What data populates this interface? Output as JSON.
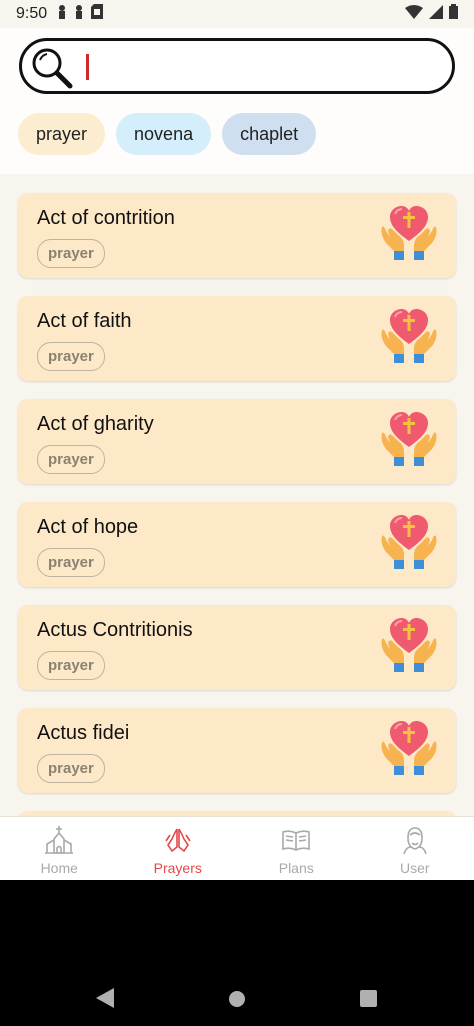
{
  "status_bar": {
    "time": "9:50"
  },
  "search": {
    "value": "",
    "placeholder": ""
  },
  "chips": [
    {
      "label": "prayer"
    },
    {
      "label": "novena"
    },
    {
      "label": "chaplet"
    }
  ],
  "items": [
    {
      "title": "Act of contrition",
      "tag": "prayer"
    },
    {
      "title": "Act of faith",
      "tag": "prayer"
    },
    {
      "title": "Act of gharity",
      "tag": "prayer"
    },
    {
      "title": "Act of hope",
      "tag": "prayer"
    },
    {
      "title": "Actus Contritionis",
      "tag": "prayer"
    },
    {
      "title": "Actus fidei",
      "tag": "prayer"
    }
  ],
  "nav": [
    {
      "label": "Home",
      "icon": "church-icon",
      "active": false
    },
    {
      "label": "Prayers",
      "icon": "praying-hands-icon",
      "active": true
    },
    {
      "label": "Plans",
      "icon": "book-icon",
      "active": false
    },
    {
      "label": "User",
      "icon": "user-icon",
      "active": false
    }
  ],
  "colors": {
    "card_bg": "#fde9c7",
    "accent": "#e54848",
    "chip_prayer": "#fcecd0",
    "chip_novena": "#d5eefb",
    "chip_chaplet": "#cfdff0"
  }
}
